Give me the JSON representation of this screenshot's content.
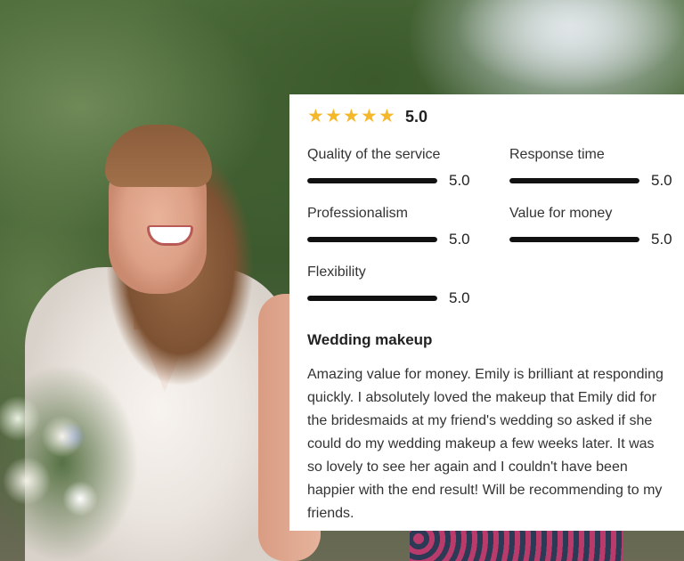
{
  "review": {
    "overall": {
      "rating": 5,
      "max": 5,
      "value_label": "5.0",
      "star_icon": "star-icon",
      "star_color": "#f5b829"
    },
    "categories": [
      {
        "label": "Quality of the service",
        "value": "5.0",
        "fraction": 1.0
      },
      {
        "label": "Response time",
        "value": "5.0",
        "fraction": 1.0
      },
      {
        "label": "Professionalism",
        "value": "5.0",
        "fraction": 1.0
      },
      {
        "label": "Value for money",
        "value": "5.0",
        "fraction": 1.0
      },
      {
        "label": "Flexibility",
        "value": "5.0",
        "fraction": 1.0
      }
    ],
    "title": "Wedding makeup",
    "text": "Amazing value for money. Emily is brilliant at responding quickly. I absolutely loved the makeup that Emily did for the bridesmaids at my friend's wedding so asked if she could do my wedding makeup a few weeks later. It was so lovely to see her again and I couldn't have been happier with the end result! Will be recommending to my friends.",
    "bar_color": "#111111",
    "card_background": "#ffffff"
  }
}
